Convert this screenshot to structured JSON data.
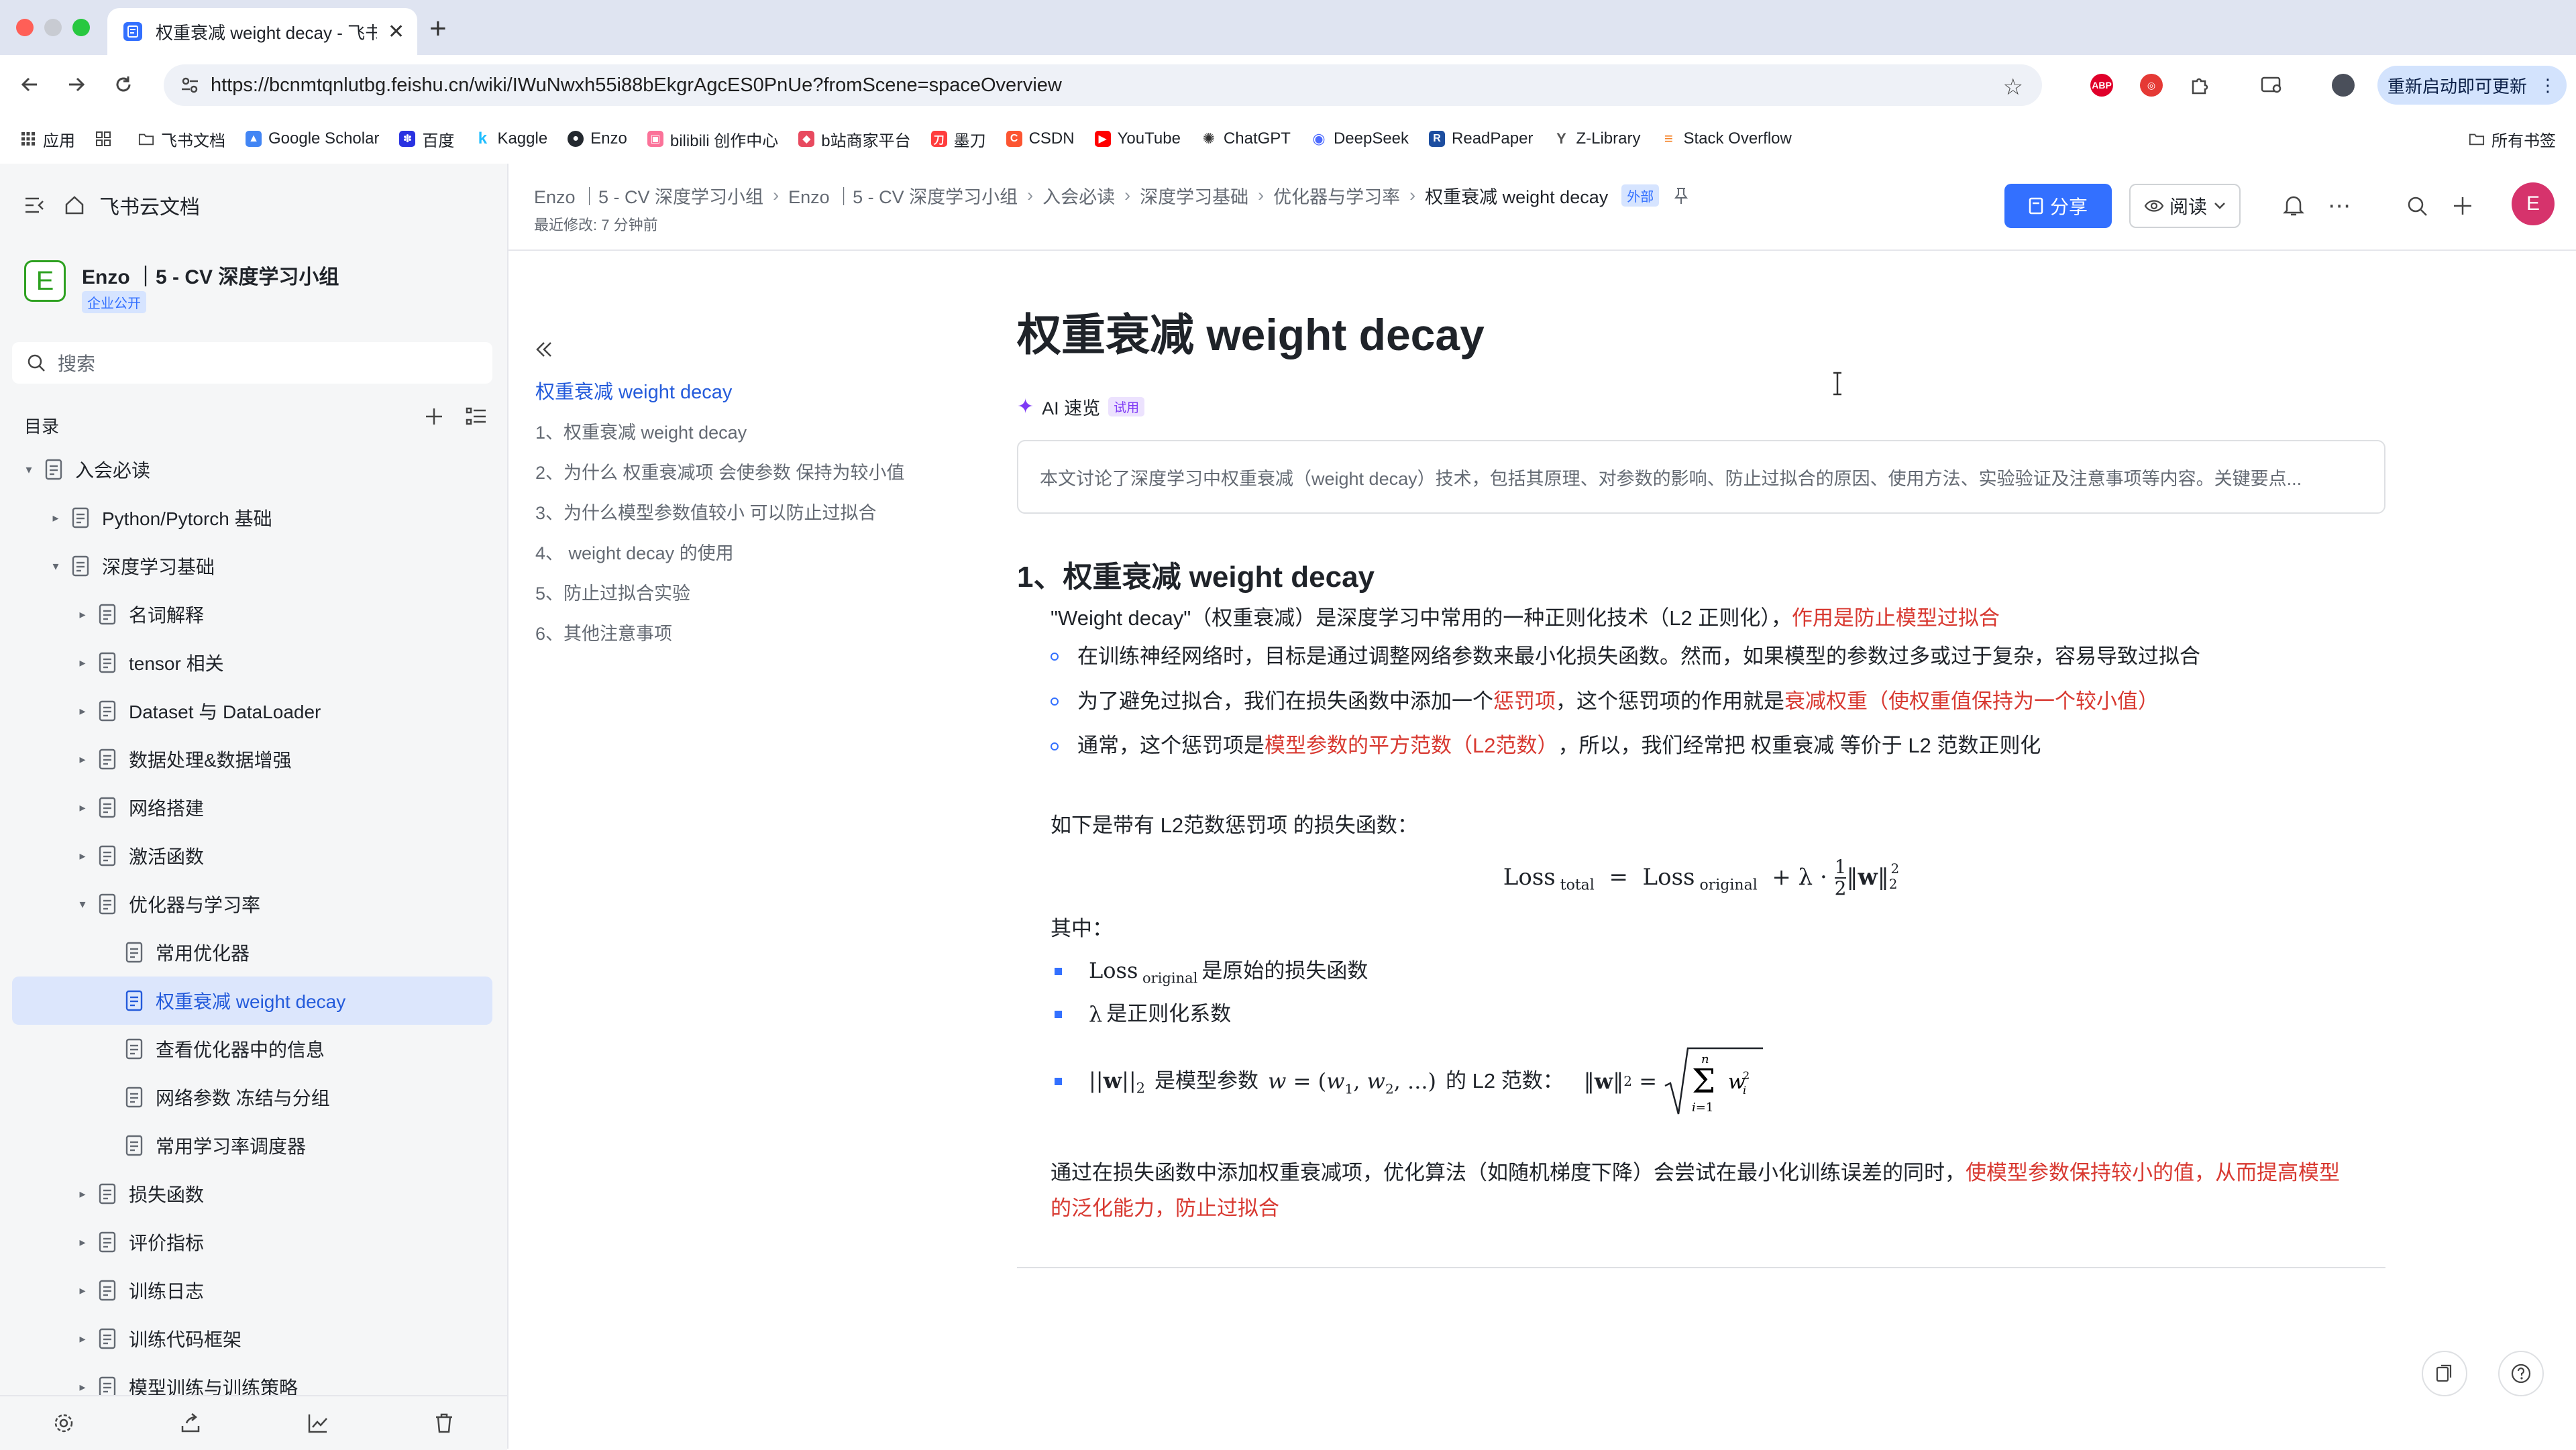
{
  "browser": {
    "tab_title": "权重衰减 weight decay - 飞书云文档",
    "url": "https://bcnmtqnlutbg.feishu.cn/wiki/IWuNwxh55i88bEkgrAgcES0PnUe?fromScene=spaceOverview",
    "restart_label": "重新启动即可更新",
    "bookmarks": [
      "应用",
      "飞书文档",
      "Google Scholar",
      "百度",
      "Kaggle",
      "Enzo",
      "bilibili 创作中心",
      "b站商家平台",
      "墨刀",
      "CSDN",
      "YouTube",
      "ChatGPT",
      "DeepSeek",
      "ReadPaper",
      "Z-Library",
      "Stack Overflow"
    ],
    "all_bookmarks": "所有书签"
  },
  "sidebar": {
    "home_label": "飞书云文档",
    "space_name": "Enzo ｜5 - CV 深度学习小组",
    "space_avatar": "E",
    "space_badge": "企业公开",
    "search_placeholder": "搜索",
    "toc_label": "目录",
    "tree": [
      {
        "label": "入会必读",
        "level": 0,
        "expanded": true
      },
      {
        "label": "Python/Pytorch 基础",
        "level": 1,
        "expanded": false
      },
      {
        "label": "深度学习基础",
        "level": 1,
        "expanded": true
      },
      {
        "label": "名词解释",
        "level": 2,
        "expanded": false
      },
      {
        "label": "tensor 相关",
        "level": 2,
        "expanded": false
      },
      {
        "label": "Dataset 与 DataLoader",
        "level": 2,
        "expanded": false
      },
      {
        "label": "数据处理&数据增强",
        "level": 2,
        "expanded": false
      },
      {
        "label": "网络搭建",
        "level": 2,
        "expanded": false
      },
      {
        "label": "激活函数",
        "level": 2,
        "expanded": false
      },
      {
        "label": "优化器与学习率",
        "level": 2,
        "expanded": true
      },
      {
        "label": "常用优化器",
        "level": 3,
        "leaf": true
      },
      {
        "label": "权重衰减 weight decay",
        "level": 3,
        "leaf": true,
        "active": true
      },
      {
        "label": "查看优化器中的信息",
        "level": 3,
        "leaf": true
      },
      {
        "label": "网络参数 冻结与分组",
        "level": 3,
        "leaf": true
      },
      {
        "label": "常用学习率调度器",
        "level": 3,
        "leaf": true
      },
      {
        "label": "损失函数",
        "level": 2,
        "expanded": false
      },
      {
        "label": "评价指标",
        "level": 2,
        "expanded": false
      },
      {
        "label": "训练日志",
        "level": 2,
        "expanded": false
      },
      {
        "label": "训练代码框架",
        "level": 2,
        "expanded": false
      },
      {
        "label": "模型训练与训练策略",
        "level": 2,
        "expanded": false
      }
    ]
  },
  "header": {
    "breadcrumbs": [
      "Enzo ｜5 - CV 深度学习小组",
      "Enzo ｜5 - CV 深度学习小组",
      "入会必读",
      "深度学习基础",
      "优化器与学习率",
      "权重衰减 weight decay"
    ],
    "external_badge": "外部",
    "last_modified": "最近修改: 7 分钟前",
    "share_label": "分享",
    "read_label": "阅读",
    "user_avatar": "E"
  },
  "outline": {
    "title": "权重衰减 weight decay",
    "items": [
      "1、权重衰减 weight decay",
      "2、为什么 权重衰减项 会使参数 保持为较小值",
      "3、为什么模型参数值较小 可以防止过拟合",
      "4、 weight decay 的使用",
      "5、防止过拟合实验",
      "6、其他注意事项"
    ]
  },
  "doc": {
    "title": "权重衰减 weight decay",
    "ai_label": "AI 速览",
    "ai_badge": "试用",
    "ai_summary": "本文讨论了深度学习中权重衰减（weight decay）技术，包括其原理、对参数的影响、防止过拟合的原因、使用方法、实验验证及注意事项等内容。关键要点...",
    "h1": "1、权重衰减 weight decay",
    "intro_a": "\"Weight decay\"（权重衰减）是深度学习中常用的一种正则化技术（L2 正则化），",
    "intro_b": "作用是防止模型过拟合",
    "b1": "在训练神经网络时，目标是通过调整网络参数来最小化损失函数。然而，如果模型的参数过多或过于复杂，容易导致过拟合",
    "b2_a": "为了避免过拟合，我们在损失函数中添加一个",
    "b2_b": "惩罚项",
    "b2_c": "，这个惩罚项的作用就是 ",
    "b2_d": "衰减权重（使权重值保持为一个较小值）",
    "b3_a": "通常，这个惩罚项是 ",
    "b3_b": "模型参数的平方范数（L2范数）",
    "b3_c": "，所以，我们经常把 权重衰减 等价于  L2 范数正则化",
    "loss_intro": "如下是带有 L2范数惩罚项 的损失函数：",
    "where": "其中：",
    "w1": "是原始的损失函数",
    "w2": "是正则化系数",
    "w3_a": "是模型参数",
    "w3_b": "的 L2 范数：",
    "concl_a": "通过在损失函数中添加权重衰减项，优化算法（如随机梯度下降）会尝试在最小化训练误差的同时，",
    "concl_b": "使模型参数保持较小的值，从而提高模型",
    "concl_c": "的泛化能力，防止过拟合"
  },
  "colors": {
    "accent": "#3370ff",
    "highlight_red": "#d83931",
    "active_bg": "#dce6fc"
  }
}
